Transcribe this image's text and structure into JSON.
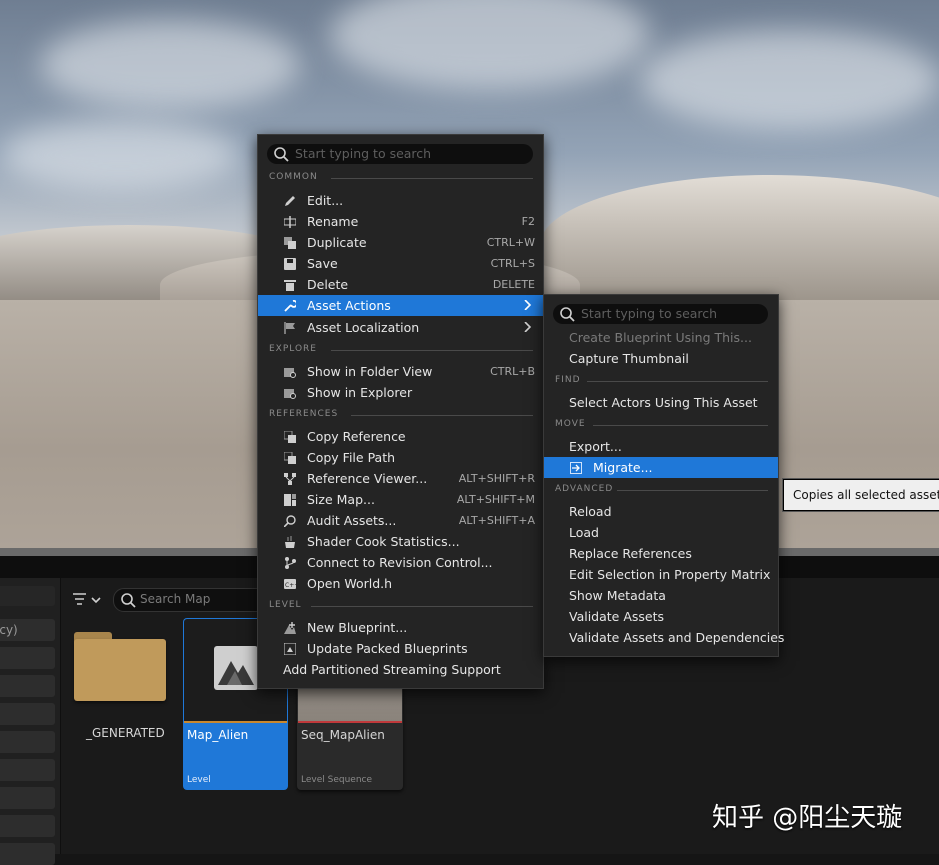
{
  "main_menu": {
    "search_placeholder": "Start typing to search",
    "sections": {
      "common": "COMMON",
      "explore": "EXPLORE",
      "references": "REFERENCES",
      "level": "LEVEL"
    },
    "common_items": [
      {
        "label": "Edit...",
        "shortcut": "",
        "icon": "pencil-icon"
      },
      {
        "label": "Rename",
        "shortcut": "F2",
        "icon": "rename-icon"
      },
      {
        "label": "Duplicate",
        "shortcut": "CTRL+W",
        "icon": "duplicate-icon"
      },
      {
        "label": "Save",
        "shortcut": "CTRL+S",
        "icon": "save-icon"
      },
      {
        "label": "Delete",
        "shortcut": "DELETE",
        "icon": "trash-icon"
      },
      {
        "label": "Asset Actions",
        "shortcut": "",
        "icon": "wrench-icon"
      },
      {
        "label": "Asset Localization",
        "shortcut": "",
        "icon": "flag-icon"
      }
    ],
    "explore_items": [
      {
        "label": "Show in Folder View",
        "shortcut": "CTRL+B"
      },
      {
        "label": "Show in Explorer",
        "shortcut": ""
      }
    ],
    "reference_items": [
      {
        "label": "Copy Reference",
        "shortcut": ""
      },
      {
        "label": "Copy File Path",
        "shortcut": ""
      },
      {
        "label": "Reference Viewer...",
        "shortcut": "ALT+SHIFT+R"
      },
      {
        "label": "Size Map...",
        "shortcut": "ALT+SHIFT+M"
      },
      {
        "label": "Audit Assets...",
        "shortcut": "ALT+SHIFT+A"
      },
      {
        "label": "Shader Cook Statistics...",
        "shortcut": ""
      },
      {
        "label": "Connect to Revision Control...",
        "shortcut": ""
      },
      {
        "label": "Open World.h",
        "shortcut": ""
      }
    ],
    "level_items": [
      {
        "label": "New Blueprint..."
      },
      {
        "label": "Update Packed Blueprints"
      },
      {
        "label": "Add Partitioned Streaming Support"
      }
    ]
  },
  "sub_menu": {
    "search_placeholder": "Start typing to search",
    "sections": {
      "find": "FIND",
      "move": "MOVE",
      "advanced": "ADVANCED"
    },
    "top_items": [
      {
        "label": "Create Blueprint Using This...",
        "disabled": true
      },
      {
        "label": "Capture Thumbnail",
        "disabled": false
      }
    ],
    "find_items": [
      "Select Actors Using This Asset"
    ],
    "move_items": [
      "Export...",
      "Migrate..."
    ],
    "advanced_items": [
      "Reload",
      "Load",
      "Replace References",
      "Edit Selection in Property Matrix",
      "Show Metadata",
      "Validate Assets",
      "Validate Assets and Dependencies"
    ]
  },
  "tooltip": "Copies all selected assets a",
  "content_browser": {
    "search_placeholder": "Search Map",
    "left_row_label": "acy)",
    "assets": [
      {
        "name": "_GENERATED",
        "type": ""
      },
      {
        "name": "Map_Alien",
        "type": "Level"
      },
      {
        "name": "Seq_MapAlien",
        "type": "Level Sequence"
      }
    ]
  },
  "watermark": "知乎 @阳尘天璇",
  "colors": {
    "highlight": "#1f78d8",
    "menu_bg": "#242424",
    "folder": "#c09a5b"
  }
}
